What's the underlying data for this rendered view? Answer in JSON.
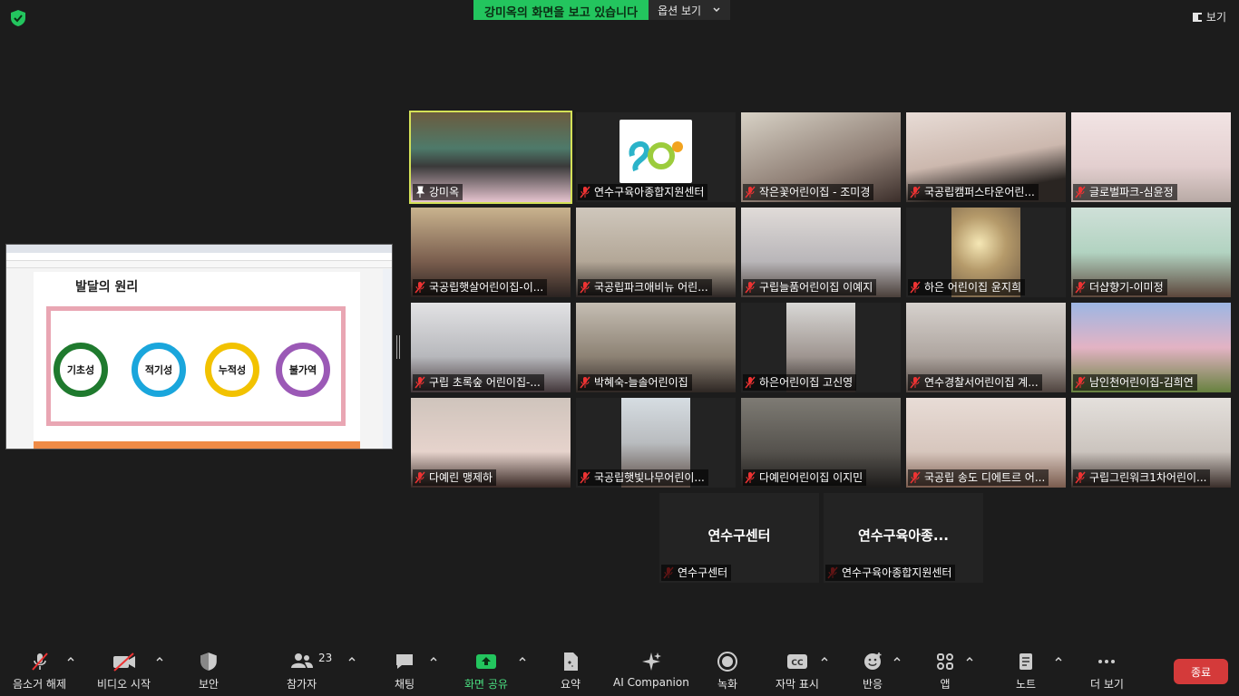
{
  "top": {
    "share_banner": "강미옥의 화면을 보고 있습니다",
    "options": "옵션 보기",
    "view": "보기"
  },
  "shared_screen": {
    "slide_title": "발달의 원리",
    "principles": [
      "기초성",
      "적기성",
      "누적성",
      "불가역"
    ],
    "principle_colors": [
      "#1f7a2e",
      "#1aa6dc",
      "#f2c200",
      "#9b59b6"
    ]
  },
  "participants": [
    "강미옥",
    "연수구육아종합지원센터",
    "작은꽃어린이집 - 조미경",
    "국공립캠퍼스타운어린...",
    "글로벌파크-심윤정",
    "국공립햇살어린이집-이...",
    "국공립파크애비뉴 어린...",
    "구립늘품어린이집 이예지",
    "하은 어린이집 윤지희",
    "더샵향기-이미정",
    "구립 초록숲 어린이집-...",
    "박혜숙-늘솔어린이집",
    "하은어린이집 고신영",
    "연수경찰서어린이집 계...",
    "남인천어린이집-김희연",
    "다예린 맹제하",
    "국공립햇빛나무어린이...",
    "다예린어린이집 이지민",
    "국공립 송도 디에트르 어...",
    "구립그린워크1차어린이..."
  ],
  "no_video": [
    {
      "center": "연수구센터",
      "label": "연수구센터"
    },
    {
      "center": "연수구육아종...",
      "label": "연수구육아종합지원센터"
    }
  ],
  "toolbar": {
    "unmute": "음소거 해제",
    "start_video": "비디오 시작",
    "security": "보안",
    "participants": "참가자",
    "participant_count": "23",
    "chat": "채팅",
    "share": "화면 공유",
    "summary": "요약",
    "ai": "AI Companion",
    "record": "녹화",
    "captions": "자막 표시",
    "reactions": "반응",
    "apps": "앱",
    "notes": "노트",
    "more": "더 보기",
    "end": "종료"
  }
}
